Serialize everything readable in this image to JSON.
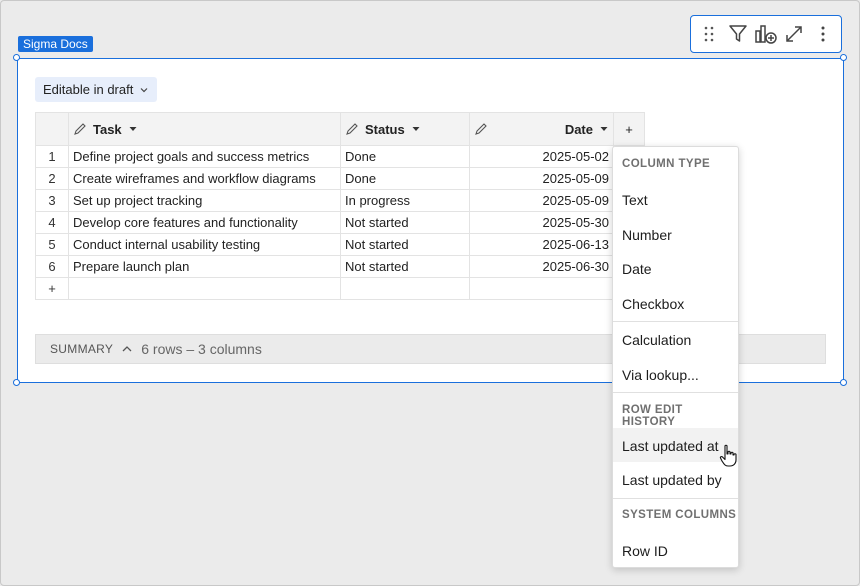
{
  "workbook_tag": "Sigma Docs",
  "toolbar": {
    "drag_icon": "drag-handle-icon",
    "filter_icon": "filter-icon",
    "add_chart_icon": "add-chart-icon",
    "expand_icon": "expand-icon",
    "more_icon": "more-vertical-icon"
  },
  "edit_mode": {
    "label": "Editable in draft",
    "icon": "chevron-down-icon"
  },
  "table": {
    "columns": [
      {
        "label": "Task",
        "icon": "pencil-icon"
      },
      {
        "label": "Status",
        "icon": "pencil-icon"
      },
      {
        "label": "Date",
        "icon": "pencil-icon"
      }
    ],
    "add_column_label": "+",
    "rows": [
      {
        "num": "1",
        "task": "Define project goals and success metrics",
        "status": "Done",
        "date": "2025-05-02"
      },
      {
        "num": "2",
        "task": "Create wireframes and workflow diagrams",
        "status": "Done",
        "date": "2025-05-09"
      },
      {
        "num": "3",
        "task": "Set up project tracking",
        "status": "In progress",
        "date": "2025-05-09"
      },
      {
        "num": "4",
        "task": "Develop core features and functionality",
        "status": "Not started",
        "date": "2025-05-30"
      },
      {
        "num": "5",
        "task": "Conduct internal usability testing",
        "status": "Not started",
        "date": "2025-06-13"
      },
      {
        "num": "6",
        "task": "Prepare launch plan",
        "status": "Not started",
        "date": "2025-06-30"
      }
    ],
    "add_row_label": "+"
  },
  "summary": {
    "label": "SUMMARY",
    "info": "6 rows – 3 columns",
    "icon": "chevron-up-icon"
  },
  "menu": {
    "column_type_header": "COLUMN TYPE",
    "types": [
      "Text",
      "Number",
      "Date",
      "Checkbox"
    ],
    "calculation": "Calculation",
    "lookup": "Via lookup...",
    "row_edit_history_header": "ROW EDIT HISTORY",
    "last_updated_at": "Last updated at",
    "last_updated_by": "Last updated by",
    "system_columns_header": "SYSTEM COLUMNS",
    "row_id": "Row ID"
  },
  "colors": {
    "accent": "#1a6fdc",
    "pill_bg": "#e7eefb"
  }
}
